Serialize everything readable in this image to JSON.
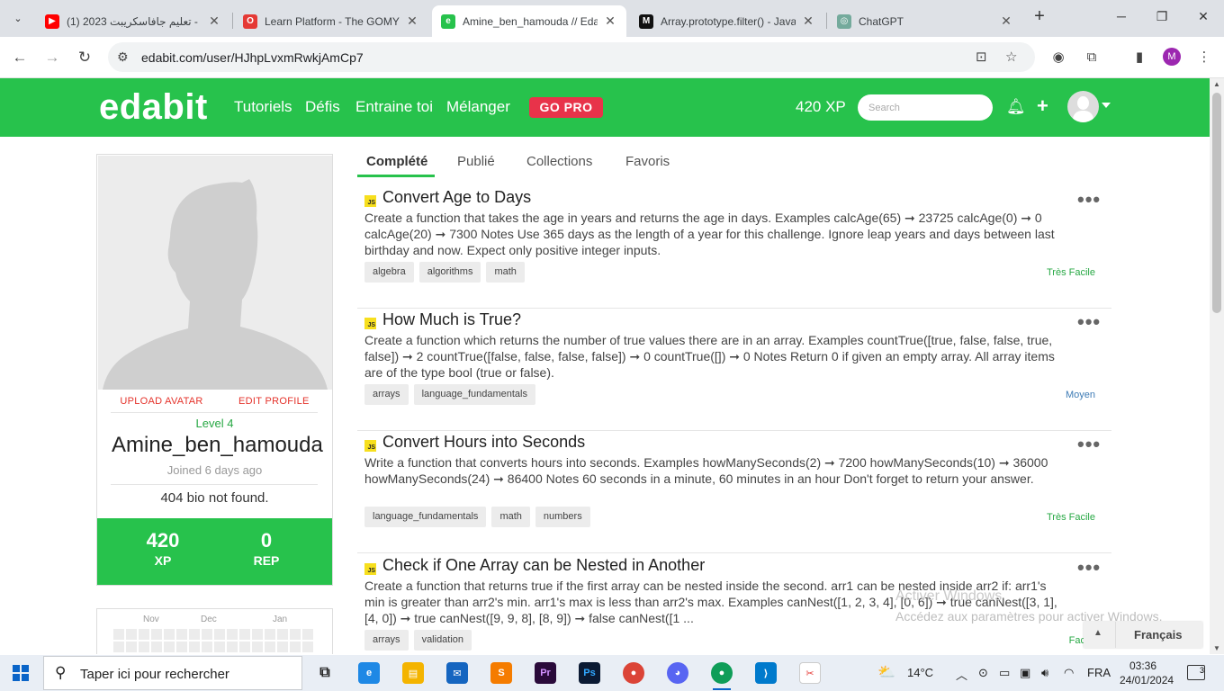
{
  "browser": {
    "tabs": [
      {
        "title": "(1) تعليم جافاسكريبت 2023 -",
        "fav_color": "#ff0000",
        "fav_glyph": "▶",
        "active": false
      },
      {
        "title": "Learn Platform - The GOMYC",
        "fav_color": "#e53935",
        "fav_glyph": "O",
        "active": false
      },
      {
        "title": "Amine_ben_hamouda // Edabit",
        "fav_color": "#27c24c",
        "fav_glyph": "e",
        "active": true
      },
      {
        "title": "Array.prototype.filter() - JavaS",
        "fav_color": "#111111",
        "fav_glyph": "M",
        "active": false
      },
      {
        "title": "ChatGPT",
        "fav_color": "#74aa9c",
        "fav_glyph": "◎",
        "active": false
      }
    ],
    "url": "edabit.com/user/HJhpLvxmRwkjAmCp7",
    "profile_initial": "M"
  },
  "header": {
    "logo": "edabit",
    "nav": [
      "Tutoriels",
      "Défis",
      "Entraine toi",
      "Mélanger"
    ],
    "go_pro": "GO PRO",
    "xp": "420 XP",
    "search_placeholder": "Search",
    "brand_color": "#27c24c"
  },
  "profile": {
    "upload_avatar": "UPLOAD AVATAR",
    "edit_profile": "EDIT PROFILE",
    "level": "Level 4",
    "username": "Amine_ben_hamouda",
    "joined": "Joined 6 days ago",
    "bio": "404 bio not found.",
    "xp_value": "420",
    "xp_label": "XP",
    "rep_value": "0",
    "rep_label": "REP"
  },
  "activity": {
    "months": [
      "Nov",
      "Dec",
      "Jan"
    ]
  },
  "profile_tabs": [
    "Complété",
    "Publié",
    "Collections",
    "Favoris"
  ],
  "challenges": [
    {
      "title": "Convert Age to Days",
      "description": "Create a function that takes the age in years and returns the age in days. Examples calcAge(65) ➞ 23725 calcAge(0) ➞ 0 calcAge(20) ➞ 7300 Notes Use 365 days as the length of a year for this challenge. Ignore leap years and days between last birthday and now. Expect only positive integer inputs.",
      "tags": [
        "algebra",
        "algorithms",
        "math"
      ],
      "difficulty": "Très Facile",
      "difficulty_color": "#27a844"
    },
    {
      "title": "How Much is True?",
      "description": "Create a function which returns the number of true values there are in an array. Examples countTrue([true, false, false, true, false]) ➞ 2 countTrue([false, false, false, false]) ➞ 0 countTrue([]) ➞ 0 Notes Return 0 if given an empty array. All array items are of the type bool (true or false).",
      "tags": [
        "arrays",
        "language_fundamentals"
      ],
      "difficulty": "Moyen",
      "difficulty_color": "#3d7bb5"
    },
    {
      "title": "Convert Hours into Seconds",
      "description": "Write a function that converts hours into seconds. Examples howManySeconds(2) ➞ 7200 howManySeconds(10) ➞ 36000 howManySeconds(24) ➞ 86400 Notes 60 seconds in a minute, 60 minutes in an hour Don't forget to return your answer.",
      "tags": [
        "language_fundamentals",
        "math",
        "numbers"
      ],
      "difficulty": "Très Facile",
      "difficulty_color": "#27a844"
    },
    {
      "title": "Check if One Array can be Nested in Another",
      "description": "Create a function that returns true if the first array can be nested inside the second. arr1 can be nested inside arr2 if: arr1's min is greater than arr2's min. arr1's max is less than arr2's max. Examples canNest([1, 2, 3, 4], [0, 6]) ➞ true canNest([3, 1], [4, 0]) ➞ true canNest([9, 9, 8], [8, 9]) ➞ false canNest([1 ...",
      "tags": [
        "arrays",
        "validation"
      ],
      "difficulty": "Facile",
      "difficulty_color": "#27a844"
    }
  ],
  "windows": {
    "activate_title": "Activer Windows",
    "activate_sub": "Accédez aux paramètres pour activer Windows.",
    "language": "Français",
    "taskbar_search": "Taper ici pour rechercher",
    "weather": "14°C",
    "input_lang": "FRA",
    "time": "03:36",
    "date": "24/01/2024",
    "notifications": "3"
  }
}
